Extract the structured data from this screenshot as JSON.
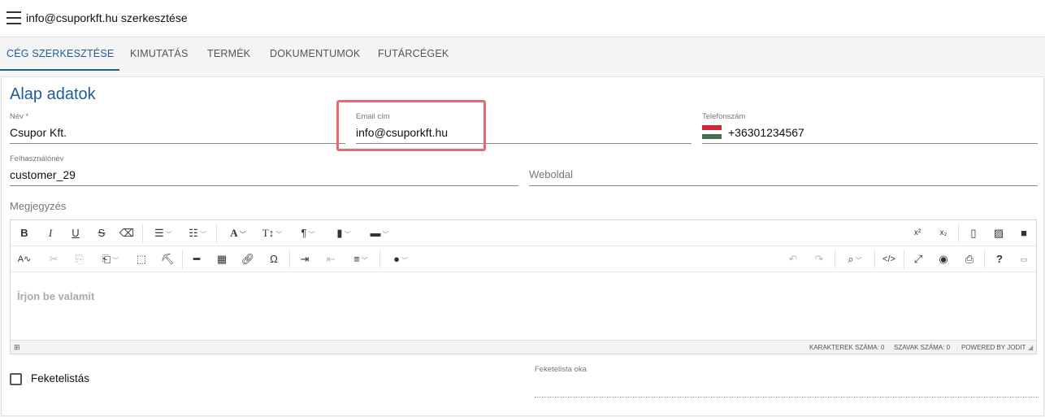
{
  "header": {
    "title": "info@csuporkft.hu szerkesztése"
  },
  "tabs": [
    {
      "label": "CÉG SZERKESZTÉSE",
      "active": true
    },
    {
      "label": "KIMUTATÁS"
    },
    {
      "label": "TERMÉK"
    },
    {
      "label": "DOKUMENTUMOK"
    },
    {
      "label": "FUTÁRCÉGEK"
    }
  ],
  "section_title": "Alap adatok",
  "fields": {
    "name": {
      "label": "Név *",
      "value": "Csupor Kft."
    },
    "email": {
      "label": "Email cím",
      "value": "info@csuporkft.hu"
    },
    "phone": {
      "label": "Telefonszám",
      "value": "+36301234567",
      "flag_colors": [
        "#ce2939",
        "#ffffff",
        "#477050"
      ]
    },
    "username": {
      "label": "Felhasználónév",
      "value": "customer_29"
    },
    "website": {
      "label": "Weboldal"
    },
    "note": {
      "label": "Megjegyzés"
    },
    "blacklist_reason": {
      "label": "Feketelista oka"
    }
  },
  "editor": {
    "placeholder": "Írjon be valamit",
    "status": {
      "chars": "KARAKTEREK SZÁMA: 0",
      "words": "SZAVAK SZÁMA: 0",
      "powered": "POWERED BY JODIT"
    }
  },
  "blacklisted": {
    "label": "Feketelistás",
    "checked": false
  },
  "accent_color": "#1e5c99",
  "highlight_color": "#e8696e"
}
